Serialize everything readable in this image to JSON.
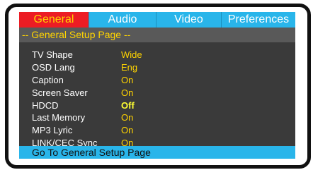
{
  "tabs": [
    {
      "label": "General",
      "active": true
    },
    {
      "label": "Audio",
      "active": false
    },
    {
      "label": "Video",
      "active": false
    },
    {
      "label": "Preferences",
      "active": false
    }
  ],
  "page_title": "-- General Setup Page --",
  "settings": [
    {
      "label": "TV Shape",
      "value": "Wide"
    },
    {
      "label": "OSD Lang",
      "value": "Eng"
    },
    {
      "label": "Caption",
      "value": "On"
    },
    {
      "label": "Screen Saver",
      "value": "On"
    },
    {
      "label": "HDCD",
      "value": "Off",
      "highlighted": true
    },
    {
      "label": "Last Memory",
      "value": "On"
    },
    {
      "label": "MP3 Lyric",
      "value": "On"
    },
    {
      "label": "LINK/CEC Sync",
      "value": "On"
    }
  ],
  "status_text": "Go To General Setup Page",
  "colors": {
    "tab_active_bg": "#ec1c24",
    "tab_bg": "#29b5ea",
    "menu_bg": "#3a3a3a",
    "title_bar_bg": "#595959",
    "value_text": "#ffd400",
    "status_bar_bg": "#29b5ea"
  }
}
